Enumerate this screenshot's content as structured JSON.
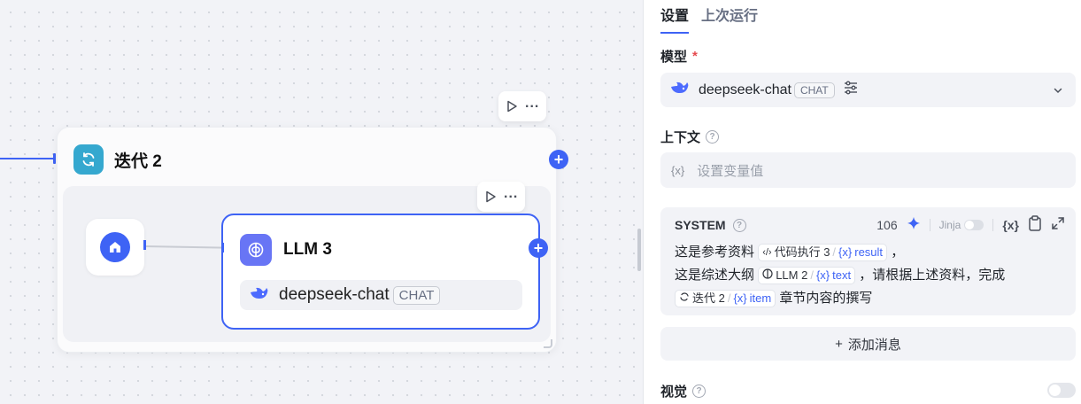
{
  "canvas": {
    "iteration_node": {
      "title": "迭代 2"
    },
    "llm_node": {
      "title": "LLM 3",
      "model_name": "deepseek-chat",
      "model_tag": "CHAT"
    }
  },
  "panel": {
    "tabs": [
      {
        "label": "设置",
        "active": true
      },
      {
        "label": "上次运行",
        "active": false
      }
    ],
    "model": {
      "label": "模型",
      "required_mark": "*",
      "name": "deepseek-chat",
      "tag": "CHAT"
    },
    "context": {
      "label": "上下文",
      "placeholder": "设置变量值",
      "var_icon": "{x}"
    },
    "system": {
      "label": "SYSTEM",
      "token_count": "106",
      "jinja_label": "Jinja",
      "var_button": "{x}",
      "line1_prefix": "这是参考资料",
      "chip1_node": "代码执行 3",
      "chip1_var": "result",
      "line1_suffix": "，",
      "line2_prefix": "这是综述大纲",
      "chip2_node": "LLM 2",
      "chip2_var": "text",
      "line2_suffix": "，请根据上述资料，完成",
      "chip3_node": "迭代 2",
      "chip3_var": "item",
      "line3_suffix": "章节内容的撰写",
      "var_prefix": "{x}",
      "sep": "/"
    },
    "add_message": {
      "icon": "+",
      "label": "添加消息"
    },
    "vision": {
      "label": "视觉",
      "enabled": false
    }
  },
  "colors": {
    "accent": "#3e63f5",
    "iteration_icon": "#35a8cf",
    "llm_icon": "#6875f5"
  },
  "icons": [
    "play-icon",
    "more-icon",
    "loop-icon",
    "home-icon",
    "brain-icon",
    "whale-icon",
    "settings-sliders-icon",
    "chevron-down-icon",
    "help-icon",
    "sparkle-icon",
    "clipboard-icon",
    "expand-icon",
    "code-icon",
    "plus-icon"
  ]
}
